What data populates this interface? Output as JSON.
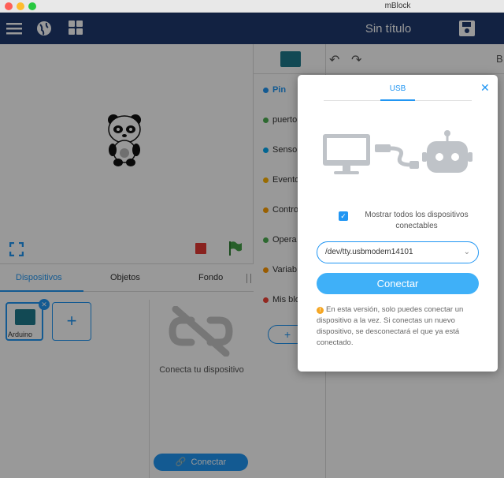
{
  "window": {
    "title": "mBlock"
  },
  "navbar": {
    "project_title": "Sin título",
    "menu_icon": "hamburger-icon",
    "globe_icon": "globe-icon",
    "apps_icon": "grid-icon",
    "save_icon": "save-icon"
  },
  "tabs": [
    {
      "label": "Dispositivos"
    },
    {
      "label": "Objetos"
    },
    {
      "label": "Fondo"
    }
  ],
  "device": {
    "name": "Arduino"
  },
  "connect_panel": {
    "message": "Conecta tu dispositivo",
    "button": "Conectar"
  },
  "categories": [
    {
      "label": "Pin",
      "color": "#2196f3"
    },
    {
      "label": "puerto",
      "color": "#4caf50"
    },
    {
      "label": "Senso",
      "color": "#03a9f4"
    },
    {
      "label": "Evento",
      "color": "#ffb300"
    },
    {
      "label": "Contro",
      "color": "#ffa000"
    },
    {
      "label": "Opera",
      "color": "#4caf50"
    },
    {
      "label": "Variab",
      "color": "#ff9800"
    },
    {
      "label": "Mis blo",
      "color": "#f44336"
    }
  ],
  "workspace": {
    "partial_label": "B"
  },
  "modal": {
    "tab": "USB",
    "checkbox_label": "Mostrar todos los dispositivos conectables",
    "port_value": "/dev/tty.usbmodem14101",
    "connect_button": "Conectar",
    "note": "En esta versión, solo puedes conectar un dispositivo a la vez. Si conectas un nuevo dispositivo, se desconectará el que ya está conectado."
  },
  "colors": {
    "accent": "#2196f3",
    "navbar": "#1e3a6e"
  }
}
